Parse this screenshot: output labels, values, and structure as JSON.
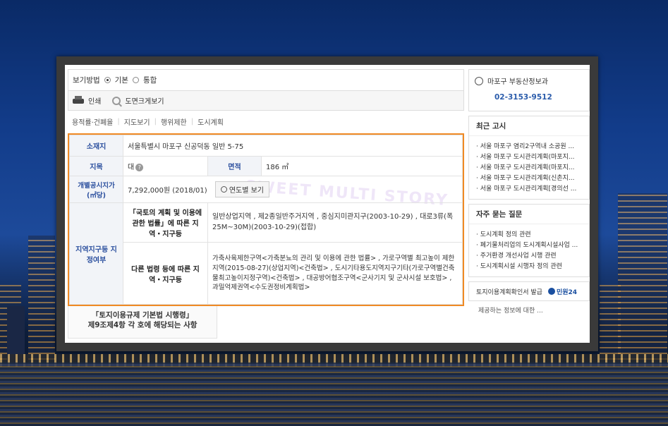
{
  "view": {
    "label": "보기방법",
    "options": [
      "기본",
      "통합"
    ],
    "selected": "기본"
  },
  "tools": {
    "print": "인쇄",
    "zoom_map": "도면크게보기"
  },
  "tabs": [
    "용적률·건폐율",
    "지도보기",
    "행위제한",
    "도시계획"
  ],
  "land": {
    "location_label": "소재지",
    "location_value": "서울특별시 마포구 신공덕동 일반 5-75",
    "jimok_label": "지목",
    "jimok_value": "대",
    "area_label": "면적",
    "area_value": "186 ㎡",
    "price_label": "개별공시지가(㎡당)",
    "price_value": "7,292,000원 (2018/01)",
    "year_button": "연도별 보기",
    "zone_label": "지역지구등 지정여부",
    "law1_label": "「국토의 계획 및 이용에 관한 법률」에 따른 지역・지구등",
    "law1_value": "일반상업지역 , 제2종일반주거지역 , 중심지미관지구(2003-10-29) , 대로3류(폭 25M~30M)(2003-10-29)(접합)",
    "law2_label": "다른 법령 등에 따른 지역・지구등",
    "law2_value": "가축사육제한구역<가축분뇨의 관리 및 이용에 관한 법률> , 가로구역별 최고높이 제한지역(2015-08-27)(상업지역)<건축법> , 도시기타용도지역지구기타(가로구역별건축물최고높이지정구역)<건축법> , 대공방어협조구역<군사기지 및 군사시설 보호법> , 과밀억제권역<수도권정비계획법>",
    "bottom_label_1": "「토지이용규제 기본법 시행령」",
    "bottom_label_2": "제9조제4항 각 호에 해당되는 사항"
  },
  "office": {
    "name": "마포구 부동산정보과",
    "phone": "02-3153-9512"
  },
  "recent": {
    "title": "최근 고시",
    "items": [
      "서울 마포구 염리2구역내 소공원 ...",
      "서울 마포구 도시관리계획(마포지...",
      "서울 마포구 도시관리계획(마포지...",
      "서울 마포구 도시관리계획(신촌지...",
      "서울 마포구 도시관리계획[경의선 ..."
    ]
  },
  "faq": {
    "title": "자주 묻는 질문",
    "items": [
      "도시계획 정의 관련",
      "폐기물처리업의 도시계획시설사업 ...",
      "주거환경 개선사업 시행 관련",
      "도시계획시설 시행자 정의 관련"
    ]
  },
  "cert": {
    "label": "토지이용계획확인서 발급",
    "brand": "민원24"
  },
  "notice": "제공하는 정보에 대한 ...",
  "watermark": "SWEET MULTI STORY"
}
